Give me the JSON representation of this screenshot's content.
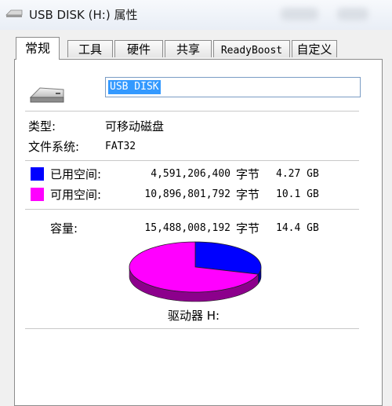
{
  "window": {
    "title": "USB DISK (H:) 属性"
  },
  "tabs": [
    {
      "label": "常规",
      "active": true
    },
    {
      "label": "工具",
      "active": false
    },
    {
      "label": "硬件",
      "active": false
    },
    {
      "label": "共享",
      "active": false
    },
    {
      "label": "ReadyBoost",
      "active": false
    },
    {
      "label": "自定义",
      "active": false
    }
  ],
  "general": {
    "drive_icon": "usb-drive-icon",
    "volume_name": "USB DISK",
    "type_label": "类型:",
    "type_value": "可移动磁盘",
    "fs_label": "文件系统:",
    "fs_value": "FAT32",
    "used": {
      "label": "已用空间:",
      "bytes": "4,591,206,400",
      "unit": "字节",
      "size": "4.27 GB",
      "color": "#0000ff"
    },
    "free": {
      "label": "可用空间:",
      "bytes": "10,896,801,792",
      "unit": "字节",
      "size": "10.1 GB",
      "color": "#ff00ff"
    },
    "capacity": {
      "label": "容量:",
      "bytes": "15,488,008,192",
      "unit": "字节",
      "size": "14.4 GB"
    },
    "drive_label": "驱动器 H:"
  },
  "chart_data": {
    "type": "pie",
    "categories": [
      "已用空间",
      "可用空间"
    ],
    "values": [
      4591206400,
      10896801792
    ],
    "colors": [
      "#0000ff",
      "#ff00ff"
    ],
    "title": "",
    "style": "3d"
  }
}
